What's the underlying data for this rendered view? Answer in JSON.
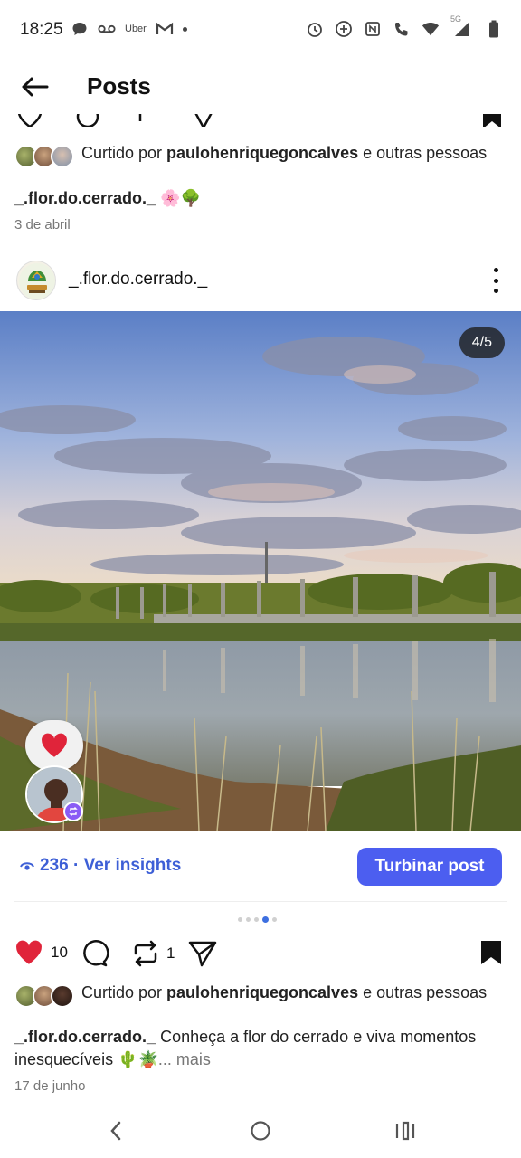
{
  "status_bar": {
    "time": "18:25",
    "network_label": "5G",
    "left_icons": [
      "chat-bubble-icon",
      "voicemail-icon",
      "uber-icon",
      "gmail-icon",
      "dot-icon"
    ],
    "uber_text": "Uber",
    "right_icons": [
      "alarm-icon",
      "data-saver-icon",
      "nfc-icon",
      "wifi-calling-icon",
      "wifi-icon",
      "signal-icon",
      "battery-icon"
    ]
  },
  "header": {
    "title": "Posts"
  },
  "previous_post": {
    "liked_prefix": "Curtido por ",
    "liked_user": "paulohenriquegoncalves",
    "liked_suffix": " e outras pessoas",
    "caption_user": "_.flor.do.cerrado._",
    "caption_text": " 🌸🌳",
    "date": "3 de abril"
  },
  "post": {
    "username": "_.flor.do.cerrado._",
    "image_counter": "4/5",
    "views": "236",
    "insights_label": " · Ver insights",
    "boost_label": "Turbinar post",
    "carousel_total": 5,
    "carousel_active": 4,
    "likes_count": "10",
    "reposts_count": "1",
    "liked_prefix": "Curtido por ",
    "liked_user": "paulohenriquegoncalves",
    "liked_suffix": " e outras pessoas",
    "caption_user": "_.flor.do.cerrado._",
    "caption_text": " Conheça a flor do cerrado e viva momentos inesquecíveis 🌵🪴",
    "caption_more": "... mais",
    "date": "17 de junho"
  },
  "colors": {
    "accent": "#4c5ef0",
    "link": "#3d5fd6",
    "like_red": "#e0243a"
  }
}
